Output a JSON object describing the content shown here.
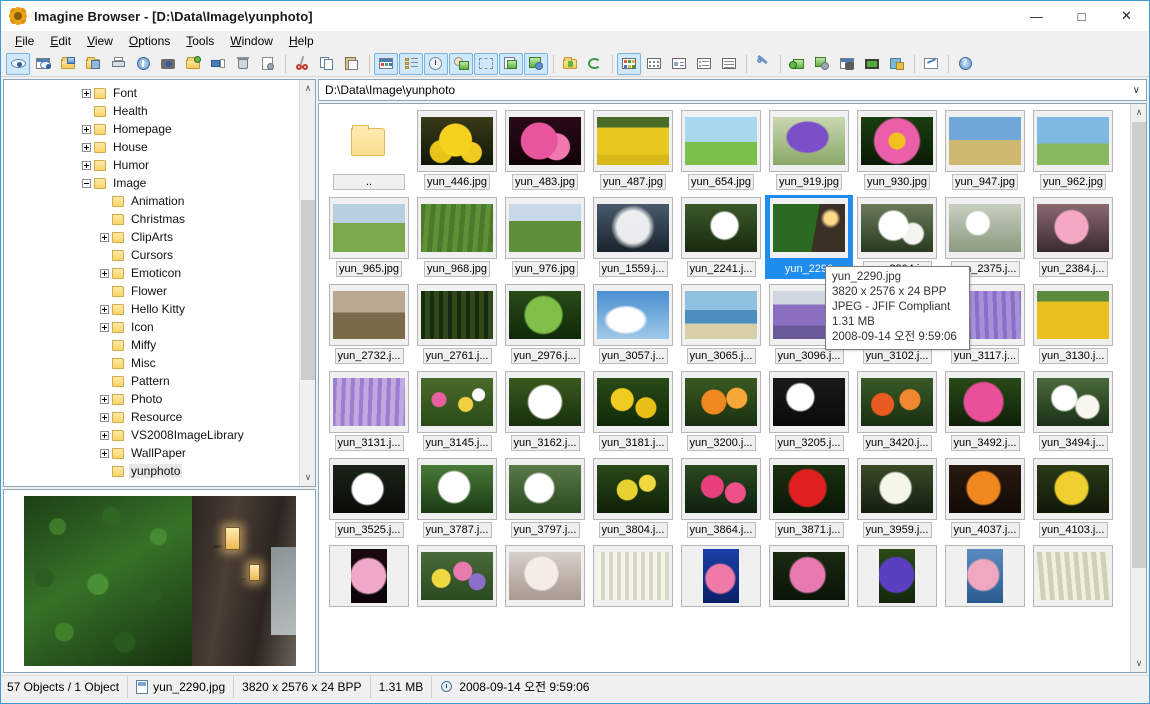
{
  "window": {
    "title": "Imagine Browser - [D:\\Data\\Image\\yunphoto]",
    "app_icon": "flower-icon",
    "minimize_label": "—",
    "maximize_label": "□",
    "close_label": "✕",
    "accent_color": "#3f9bd4",
    "selection_color": "#1f8cf0"
  },
  "menubar": {
    "items": [
      {
        "label": "File",
        "mnemonic": "F"
      },
      {
        "label": "Edit",
        "mnemonic": "E"
      },
      {
        "label": "View",
        "mnemonic": "V"
      },
      {
        "label": "Options",
        "mnemonic": "O"
      },
      {
        "label": "Tools",
        "mnemonic": "T"
      },
      {
        "label": "Window",
        "mnemonic": "W"
      },
      {
        "label": "Help",
        "mnemonic": "H"
      }
    ]
  },
  "toolbar": {
    "groups": [
      [
        "preview-eye-icon",
        "preview-window-icon",
        "open-folder-icon",
        "save-folder-icon",
        "print-icon",
        "info-icon",
        "capture-camera-icon",
        "new-folder-icon",
        "rename-icon",
        "delete-icon",
        "properties-icon"
      ],
      [
        "cut-icon",
        "copy-icon",
        "paste-icon"
      ],
      [
        "thumbnail-view-icon",
        "list-view-icon",
        "clock-view-icon",
        "sort-icon",
        "select-icon",
        "copy-image-icon",
        "move-image-icon"
      ],
      [
        "export-folder-icon",
        "refresh-icon"
      ],
      [
        "view-large-icons-icon",
        "view-small-icons-icon",
        "view-tiles-icon",
        "view-list-icon",
        "view-details-icon"
      ],
      [
        "tools-wrench-icon"
      ],
      [
        "add-image-icon",
        "batch-settings-icon",
        "screen-capture-icon",
        "filmstrip-icon",
        "slideshow-icon"
      ],
      [
        "edit-pencil-icon"
      ],
      [
        "help-icon"
      ]
    ],
    "active_indices": [
      "0-0",
      "2-0",
      "2-1",
      "2-2",
      "2-3",
      "2-4",
      "2-5",
      "2-6",
      "4-0"
    ]
  },
  "sidebar": {
    "tree": [
      {
        "label": "Font",
        "depth": 1,
        "expander": "plus"
      },
      {
        "label": "Health",
        "depth": 1,
        "expander": "none"
      },
      {
        "label": "Homepage",
        "depth": 1,
        "expander": "plus"
      },
      {
        "label": "House",
        "depth": 1,
        "expander": "plus"
      },
      {
        "label": "Humor",
        "depth": 1,
        "expander": "plus"
      },
      {
        "label": "Image",
        "depth": 1,
        "expander": "minus"
      },
      {
        "label": "Animation",
        "depth": 2,
        "expander": "none"
      },
      {
        "label": "Christmas",
        "depth": 2,
        "expander": "none"
      },
      {
        "label": "ClipArts",
        "depth": 2,
        "expander": "plus"
      },
      {
        "label": "Cursors",
        "depth": 2,
        "expander": "none"
      },
      {
        "label": "Emoticon",
        "depth": 2,
        "expander": "plus"
      },
      {
        "label": "Flower",
        "depth": 2,
        "expander": "none"
      },
      {
        "label": "Hello Kitty",
        "depth": 2,
        "expander": "plus"
      },
      {
        "label": "Icon",
        "depth": 2,
        "expander": "plus"
      },
      {
        "label": "Miffy",
        "depth": 2,
        "expander": "none"
      },
      {
        "label": "Misc",
        "depth": 2,
        "expander": "none"
      },
      {
        "label": "Pattern",
        "depth": 2,
        "expander": "none"
      },
      {
        "label": "Photo",
        "depth": 2,
        "expander": "plus"
      },
      {
        "label": "Resource",
        "depth": 2,
        "expander": "plus"
      },
      {
        "label": "VS2008ImageLibrary",
        "depth": 2,
        "expander": "plus"
      },
      {
        "label": "WallPaper",
        "depth": 2,
        "expander": "plus"
      },
      {
        "label": "yunphoto",
        "depth": 2,
        "expander": "none",
        "selected": true
      }
    ],
    "scroll_up": "∧",
    "scroll_down": "∨"
  },
  "preview": {
    "alt": "ivy-covered-wall-with-lanterns"
  },
  "address": {
    "path": "D:\\Data\\Image\\yunphoto",
    "dropdown_glyph": "∨"
  },
  "thumbnails": {
    "parent_label": "..",
    "rows": [
      [
        {
          "name": "yun_446.jpg",
          "img": "yellow-daisies"
        },
        {
          "name": "yun_483.jpg",
          "img": "pink-orchid"
        },
        {
          "name": "yun_487.jpg",
          "img": "sunflower-field"
        },
        {
          "name": "yun_654.jpg",
          "img": "lone-cypress-tree"
        },
        {
          "name": "yun_919.jpg",
          "img": "purple-salvia"
        },
        {
          "name": "yun_930.jpg",
          "img": "pink-cosmos"
        },
        {
          "name": "yun_947.jpg",
          "img": "wheat-field-sky"
        },
        {
          "name": "yun_962.jpg",
          "img": "tree-on-hill"
        }
      ],
      [
        {
          "name": "yun_965.jpg",
          "img": "green-meadow"
        },
        {
          "name": "yun_968.jpg",
          "img": "green-field-rows"
        },
        {
          "name": "yun_976.jpg",
          "img": "field-with-trees"
        },
        {
          "name": "yun_1559.j...",
          "img": "dandelion-seed"
        },
        {
          "name": "yun_2241.j...",
          "img": "white-blossom"
        },
        {
          "name": "yun_2290",
          "img": "ivy-wall-lanterns",
          "selected": true
        },
        {
          "name": "yun_2304.j...",
          "img": "white-cherry-blossom"
        },
        {
          "name": "yun_2375.j...",
          "img": "white-blossom-branch"
        },
        {
          "name": "yun_2384.j...",
          "img": "pink-cherry-blossom"
        }
      ],
      [
        {
          "name": "yun_2732.j...",
          "img": "misty-field"
        },
        {
          "name": "yun_2761.j...",
          "img": "dark-forest"
        },
        {
          "name": "yun_2976.j...",
          "img": "green-leaves"
        },
        {
          "name": "yun_3057.j...",
          "img": "blue-sky-clouds"
        },
        {
          "name": "yun_3065.j...",
          "img": "beach-sea"
        },
        {
          "name": "yun_3096.j...",
          "img": "lavender-field"
        },
        {
          "name": "yun_3102.j...",
          "img": "lavender-rows"
        },
        {
          "name": "yun_3117.j...",
          "img": "lavender-purple"
        },
        {
          "name": "yun_3130.j...",
          "img": "sunflower-rows"
        }
      ],
      [
        {
          "name": "yun_3131.j...",
          "img": "lavender-close"
        },
        {
          "name": "yun_3145.j...",
          "img": "mixed-flowers"
        },
        {
          "name": "yun_3162.j...",
          "img": "white-flower"
        },
        {
          "name": "yun_3181.j...",
          "img": "yellow-flowers"
        },
        {
          "name": "yun_3200.j...",
          "img": "orange-flowers"
        },
        {
          "name": "yun_3205.j...",
          "img": "white-bellflower"
        },
        {
          "name": "yun_3420.j...",
          "img": "orange-red-blooms"
        },
        {
          "name": "yun_3492.j...",
          "img": "pink-hibiscus"
        },
        {
          "name": "yun_3494.j...",
          "img": "white-blossoms"
        }
      ],
      [
        {
          "name": "yun_3525.j...",
          "img": "white-flower-dark"
        },
        {
          "name": "yun_3787.j...",
          "img": "white-blossom-green"
        },
        {
          "name": "yun_3797.j...",
          "img": "white-petals"
        },
        {
          "name": "yun_3804.j...",
          "img": "yellow-small-flowers"
        },
        {
          "name": "yun_3864.j...",
          "img": "pink-red-flowers"
        },
        {
          "name": "yun_3871.j...",
          "img": "red-flower"
        },
        {
          "name": "yun_3959.j...",
          "img": "white-flower-bud"
        },
        {
          "name": "yun_4037.j...",
          "img": "orange-lily"
        },
        {
          "name": "yun_4103.j...",
          "img": "yellow-bloom"
        }
      ],
      [
        {
          "name": "",
          "img": "pink-lily"
        },
        {
          "name": "",
          "img": "spring-bouquet"
        },
        {
          "name": "",
          "img": "pale-blossoms"
        },
        {
          "name": "",
          "img": "white-tulip-field"
        },
        {
          "name": "",
          "img": "pink-flower-blue"
        },
        {
          "name": "",
          "img": "pink-cosmos-dark"
        },
        {
          "name": "",
          "img": "purple-iris"
        },
        {
          "name": "",
          "img": "pink-azalea"
        },
        {
          "name": "",
          "img": "white-daffodil-field"
        }
      ]
    ],
    "scroll_up": "∧",
    "scroll_down": "∨"
  },
  "tooltip": {
    "filename": "yun_2290.jpg",
    "dimensions": "3820 x 2576 x 24 BPP",
    "format": "JPEG - JFIF Compliant",
    "filesize": "1.31 MB",
    "datetime": "2008-09-14 오전 9:59:06"
  },
  "statusbar": {
    "object_count": "57 Objects / 1 Object",
    "filename": "yun_2290.jpg",
    "dimensions": "3820 x 2576 x 24 BPP",
    "filesize": "1.31 MB",
    "datetime": "2008-09-14 오전 9:59:06"
  }
}
